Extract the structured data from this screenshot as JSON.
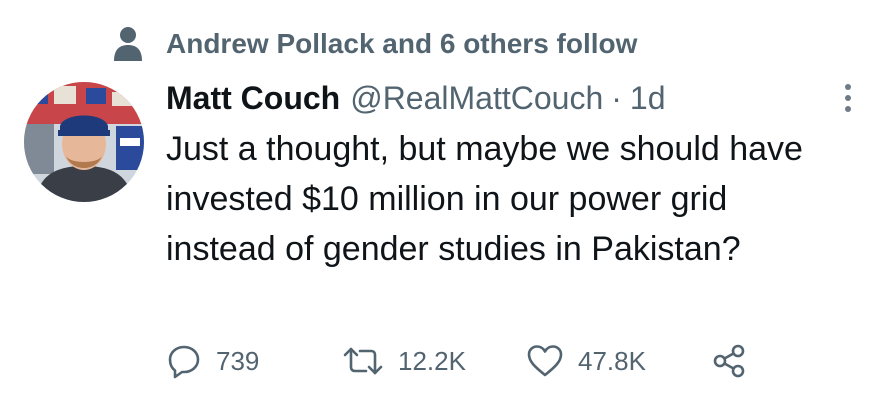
{
  "social_context": {
    "text": "Andrew Pollack and 6 others follow",
    "icon": "person-icon"
  },
  "tweet": {
    "author_name": "Matt Couch",
    "handle": "@RealMattCouch",
    "separator": "·",
    "time": "1d",
    "text": "Just a thought, but maybe we should have invested $10 million in our power grid instead of gender studies in Pakistan?",
    "avatar_icon": "profile-photo"
  },
  "actions": {
    "reply_count": "739",
    "retweet_count": "12.2K",
    "like_count": "47.8K"
  },
  "colors": {
    "primary_text": "#0f1419",
    "secondary_text": "#536471",
    "background": "#ffffff"
  }
}
